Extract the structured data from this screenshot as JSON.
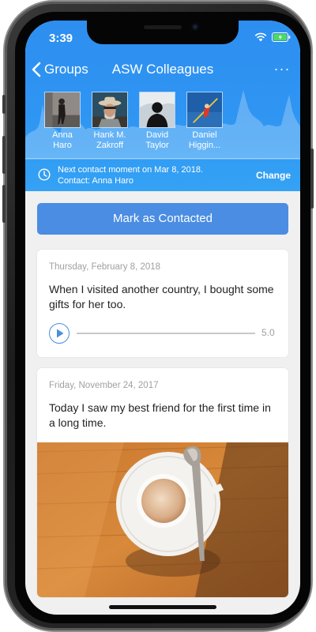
{
  "status_bar": {
    "time": "3:39"
  },
  "nav": {
    "back_label": "Groups",
    "title": "ASW Colleagues",
    "more_label": "···"
  },
  "members": [
    {
      "first": "Anna",
      "last": "Haro"
    },
    {
      "first": "Hank M.",
      "last": "Zakroff"
    },
    {
      "first": "David",
      "last": "Taylor"
    },
    {
      "first": "Daniel",
      "last": "Higgin..."
    }
  ],
  "contact_bar": {
    "line1": "Next contact moment on Mar 8, 2018.",
    "line2": "Contact: Anna Haro",
    "change_label": "Change"
  },
  "mark_button_label": "Mark as Contacted",
  "entries": [
    {
      "date": "Thursday, February 8, 2018",
      "text": "When I visited another country, I bought some gifts for her too.",
      "audio_duration": "5.0"
    },
    {
      "date": "Friday, November 24, 2017",
      "text": "Today I saw my best friend for the first time in a long time."
    }
  ],
  "colors": {
    "header_blue": "#2f95f2",
    "accent_blue": "#4a8de3",
    "background": "#f0f0f0"
  },
  "icons": [
    "wifi-icon",
    "battery-icon",
    "chevron-left-icon",
    "more-icon",
    "clock-icon",
    "play-icon"
  ]
}
